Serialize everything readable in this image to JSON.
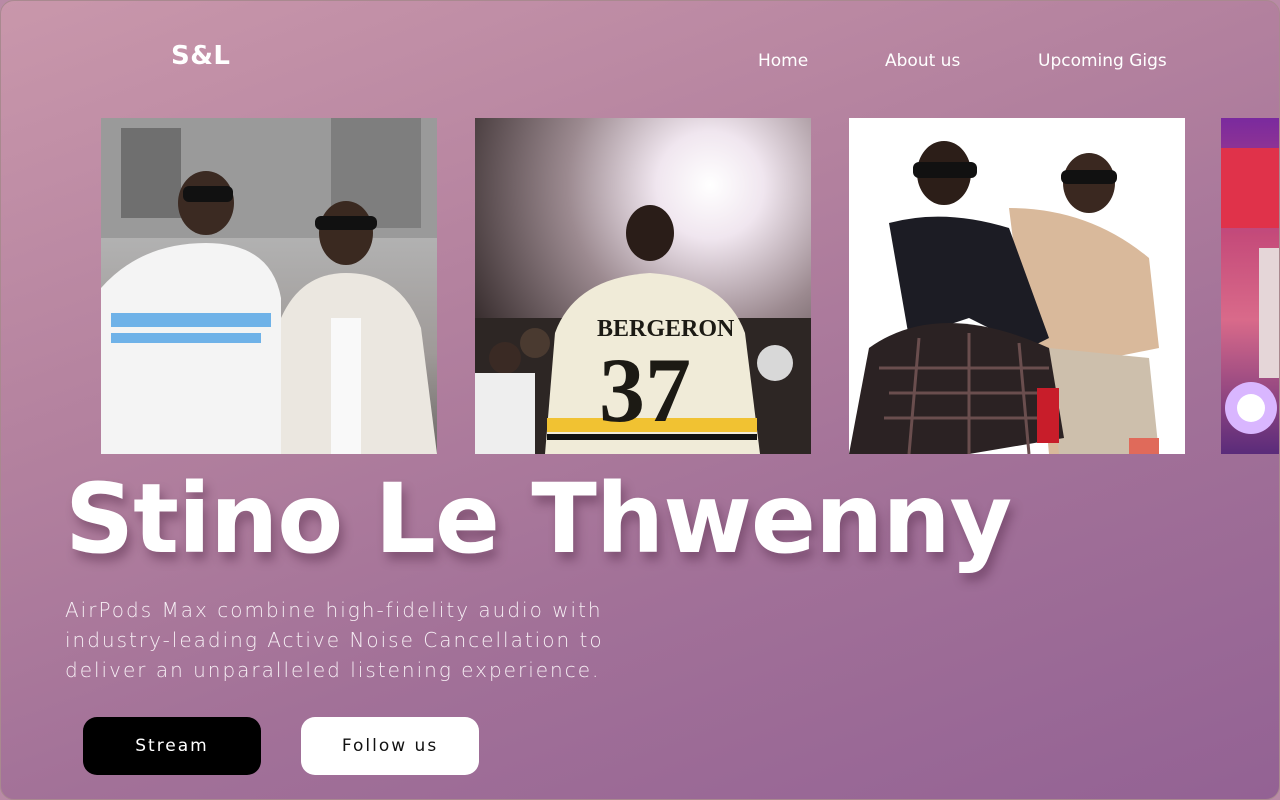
{
  "header": {
    "logo": "S&L",
    "nav": [
      {
        "label": "Home"
      },
      {
        "label": "About us"
      },
      {
        "label": "Upcoming Gigs"
      }
    ]
  },
  "gallery": {
    "jersey_name": "BERGERON",
    "jersey_number": "37"
  },
  "hero": {
    "title": "Stino Le Thwenny",
    "description": "AirPods Max combine high-fidelity audio with industry-leading Active Noise Cancellation to deliver an unparalleled listening experience."
  },
  "actions": {
    "stream_label": "Stream",
    "follow_label": "Follow us"
  }
}
